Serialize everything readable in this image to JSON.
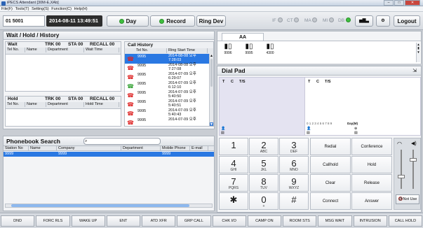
{
  "window": {
    "title": "iPECS Attendant [30M-E,XAb]"
  },
  "menu": [
    "File(F)",
    "Tools(T)",
    "Setting(S)",
    "Function(C)",
    "Help(H)"
  ],
  "toolbar": {
    "station": "01  5001",
    "datetime": "2014-08-11 13:49:51",
    "day_label": "Day",
    "record_label": "Record",
    "ringdev_label": "Ring Dev",
    "indicators": [
      "IF",
      "CT",
      "MA",
      "MI",
      "DB"
    ],
    "logout_label": "Logout"
  },
  "wait_panel": {
    "title": "Wait / Hold / History",
    "wait": {
      "label": "Wait",
      "trk": "TRK 00",
      "sta": "STA 00",
      "recall": "RECALL 00",
      "columns": [
        "Tel No.",
        "Name",
        "Department",
        "Wait Time"
      ]
    },
    "hold": {
      "label": "Hold",
      "trk": "TRK 00",
      "sta": "STA 00",
      "recall": "RECALL 00",
      "columns": [
        "Tel No.",
        "Name",
        "Department",
        "Hold Time"
      ]
    }
  },
  "call_history": {
    "title": "Call History",
    "columns": [
      "Tel No.",
      "Ring Start Time"
    ],
    "rows": [
      {
        "tel": "9995",
        "time1": "2014-08-08 오후",
        "time2": "7:28:03",
        "selected": true,
        "icon": "red"
      },
      {
        "tel": "9995",
        "time1": "2014-08-08 오후",
        "time2": "7:27:08",
        "selected": false,
        "icon": "red"
      },
      {
        "tel": "9995",
        "time1": "2014-07-09 오후",
        "time2": "6:29:07",
        "selected": false,
        "icon": "red"
      },
      {
        "tel": "9995",
        "time1": "2014-07-09 오후",
        "time2": "6:12:10",
        "selected": false,
        "icon": "green"
      },
      {
        "tel": "9995",
        "time1": "2014-07-09 오후",
        "time2": "5:40:50",
        "selected": false,
        "icon": "red"
      },
      {
        "tel": "9995",
        "time1": "2014-07-09 오후",
        "time2": "5:40:51",
        "selected": false,
        "icon": "red"
      },
      {
        "tel": "9995",
        "time1": "2014-07-09 오후",
        "time2": "5:40:43",
        "selected": false,
        "icon": "red"
      },
      {
        "tel": "9995",
        "time1": "2014-07-09 오후",
        "time2": "",
        "selected": false,
        "icon": "red"
      }
    ]
  },
  "aa_panel": {
    "tab": "AA",
    "phones": [
      "9996",
      "9995",
      "4300"
    ]
  },
  "dialpad": {
    "title": "Dial Pad",
    "line1": {
      "t": "T",
      "c": "C",
      "ts": "T/S"
    },
    "line2": {
      "t": "T",
      "c": "C",
      "ts": "T/S"
    },
    "digits_row": "0 1 2 3 4 5 6 7 8 9",
    "day_mode": "Day(M)",
    "keys": [
      {
        "n": "1",
        "l": ""
      },
      {
        "n": "2",
        "l": "ABC"
      },
      {
        "n": "3",
        "l": "DEF"
      },
      {
        "n": "4",
        "l": "GHI"
      },
      {
        "n": "5",
        "l": "JKL"
      },
      {
        "n": "6",
        "l": "MNO"
      },
      {
        "n": "7",
        "l": "PQRS"
      },
      {
        "n": "8",
        "l": "TUV"
      },
      {
        "n": "9",
        "l": "WXYZ"
      },
      {
        "n": "✱",
        "l": ""
      },
      {
        "n": "0",
        "l": "+"
      },
      {
        "n": "#",
        "l": ""
      }
    ],
    "functions": [
      "Redial",
      "Conference",
      "Callhold",
      "Hold",
      "Clear",
      "Release",
      "Connect",
      "Answer"
    ],
    "notuse_label": "Not Use"
  },
  "phonebook": {
    "title": "Phonebook Search",
    "columns": [
      "Station No",
      "Name",
      "Company",
      "Department",
      "Mobile Phone",
      "E-mail"
    ],
    "rows": [
      {
        "station": "9999",
        "name": "",
        "company": "9999",
        "department": "",
        "mobile": "9999",
        "email": ""
      }
    ]
  },
  "bottom": [
    "DND",
    "FORC RLS",
    "WAKE UP",
    "ENT",
    "ATD XFR",
    "GRP CALL",
    "CHK I/O",
    "CAMP ON",
    "ROOM STS",
    "MSG WAIT",
    "INTRUSION",
    "CALL HOLD"
  ],
  "colors": {
    "accent": "#2a78e2",
    "green": "#3fbf3f",
    "dark": "#2d2d2d"
  }
}
